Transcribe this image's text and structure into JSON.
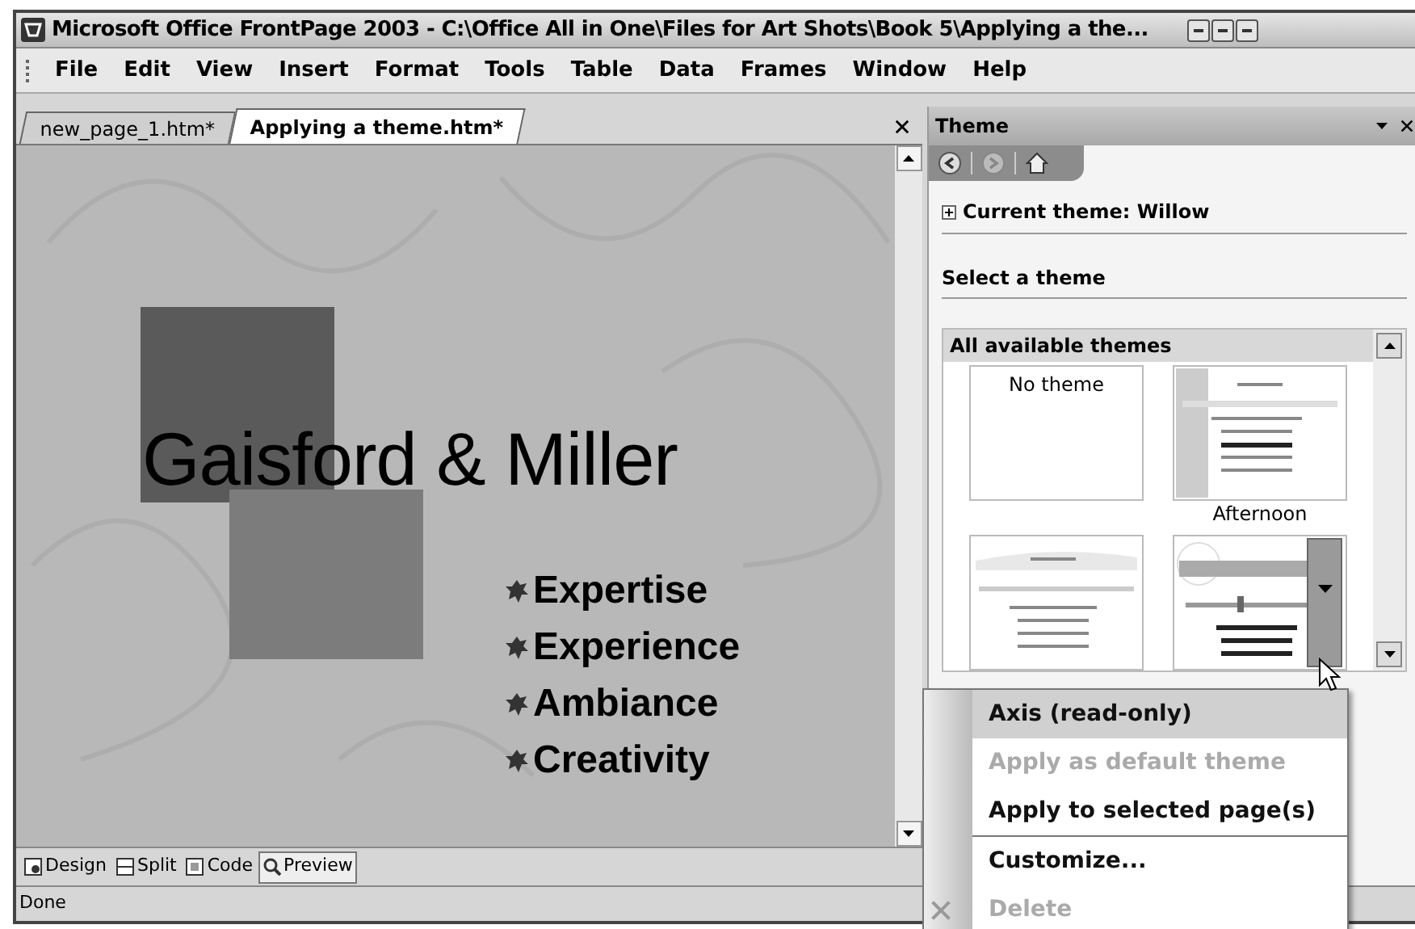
{
  "window": {
    "title": "Microsoft Office FrontPage 2003 - C:\\Office All in One\\Files for Art Shots\\Book 5\\Applying a the..."
  },
  "menu": [
    "File",
    "Edit",
    "View",
    "Insert",
    "Format",
    "Tools",
    "Table",
    "Data",
    "Frames",
    "Window",
    "Help"
  ],
  "doc_tabs": [
    {
      "label": "new_page_1.htm*",
      "selected": false
    },
    {
      "label": "Applying a theme.htm*",
      "selected": true
    }
  ],
  "page": {
    "heading": "Gaisford & Miller",
    "bullets": [
      "Expertise",
      "Experience",
      "Ambiance",
      "Creativity"
    ]
  },
  "view_tabs": [
    {
      "label": "Design",
      "kind": "design",
      "selected": false
    },
    {
      "label": "Split",
      "kind": "split",
      "selected": false
    },
    {
      "label": "Code",
      "kind": "code",
      "selected": false
    },
    {
      "label": "Preview",
      "kind": "preview",
      "selected": true
    }
  ],
  "status_bar": "Done",
  "task_pane": {
    "title": "Theme",
    "current_theme": "Current theme: Willow",
    "section": "Select a theme",
    "gallery_title": "All available themes",
    "themes": [
      {
        "label": "No theme",
        "kind": "blank",
        "selected": false
      },
      {
        "label": "Afternoon",
        "kind": "gradient",
        "selected": false
      },
      {
        "kind": "arc",
        "selected": false
      },
      {
        "kind": "axis",
        "selected": true
      }
    ]
  },
  "context_menu": [
    {
      "label": "Axis (read-only)",
      "selected": true,
      "disabled": false,
      "separator_before": false
    },
    {
      "label": "Apply as default theme",
      "selected": false,
      "disabled": true,
      "separator_before": false
    },
    {
      "label": "Apply to selected page(s)",
      "selected": false,
      "disabled": false,
      "separator_before": false
    },
    {
      "label": "Customize...",
      "selected": false,
      "disabled": false,
      "separator_before": true
    },
    {
      "label": "Delete",
      "selected": false,
      "disabled": true,
      "separator_before": false,
      "kind": "delete"
    }
  ]
}
